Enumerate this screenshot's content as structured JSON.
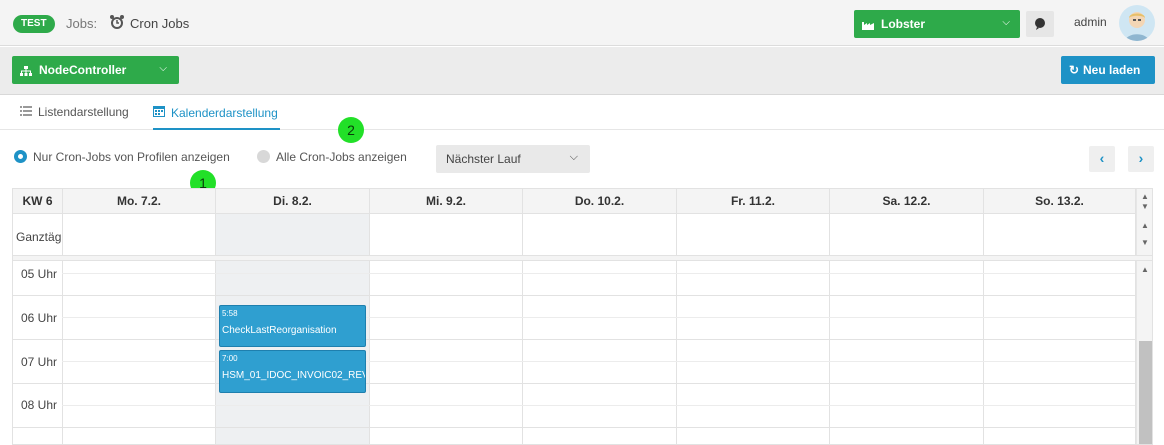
{
  "header": {
    "env_badge": "TEST",
    "breadcrumb_prefix": "Jobs:",
    "page_title": "Cron Jobs",
    "client_select": "Lobster",
    "user": "admin"
  },
  "toolbar": {
    "node_select": "NodeController",
    "reload_label": "Neu laden"
  },
  "tabs": {
    "list": "Listendarstellung",
    "calendar": "Kalenderdarstellung"
  },
  "callouts": {
    "one": "1",
    "two": "2"
  },
  "filters": {
    "radio_profiles": "Nur Cron-Jobs von Profilen anzeigen",
    "radio_all": "Alle Cron-Jobs anzeigen",
    "run_select": "Nächster Lauf"
  },
  "calendar": {
    "week_label": "KW 6",
    "days": [
      "Mo. 7.2.",
      "Di. 8.2.",
      "Mi. 9.2.",
      "Do. 10.2.",
      "Fr. 11.2.",
      "Sa. 12.2.",
      "So. 13.2."
    ],
    "allday_label": "Ganztäg",
    "hours": [
      "05 Uhr",
      "06 Uhr",
      "07 Uhr",
      "08 Uhr"
    ],
    "events": [
      {
        "day": "Di. 8.2.",
        "time": "5:58",
        "name": "CheckLastReorganisation"
      },
      {
        "day": "Di. 8.2.",
        "time": "7:00",
        "name": "HSM_01_IDOC_INVOIC02_REV"
      }
    ]
  },
  "colors": {
    "green": "#2eaa4a",
    "blue": "#1e92c6",
    "event": "#2f9fd0",
    "callout": "#22e028"
  }
}
